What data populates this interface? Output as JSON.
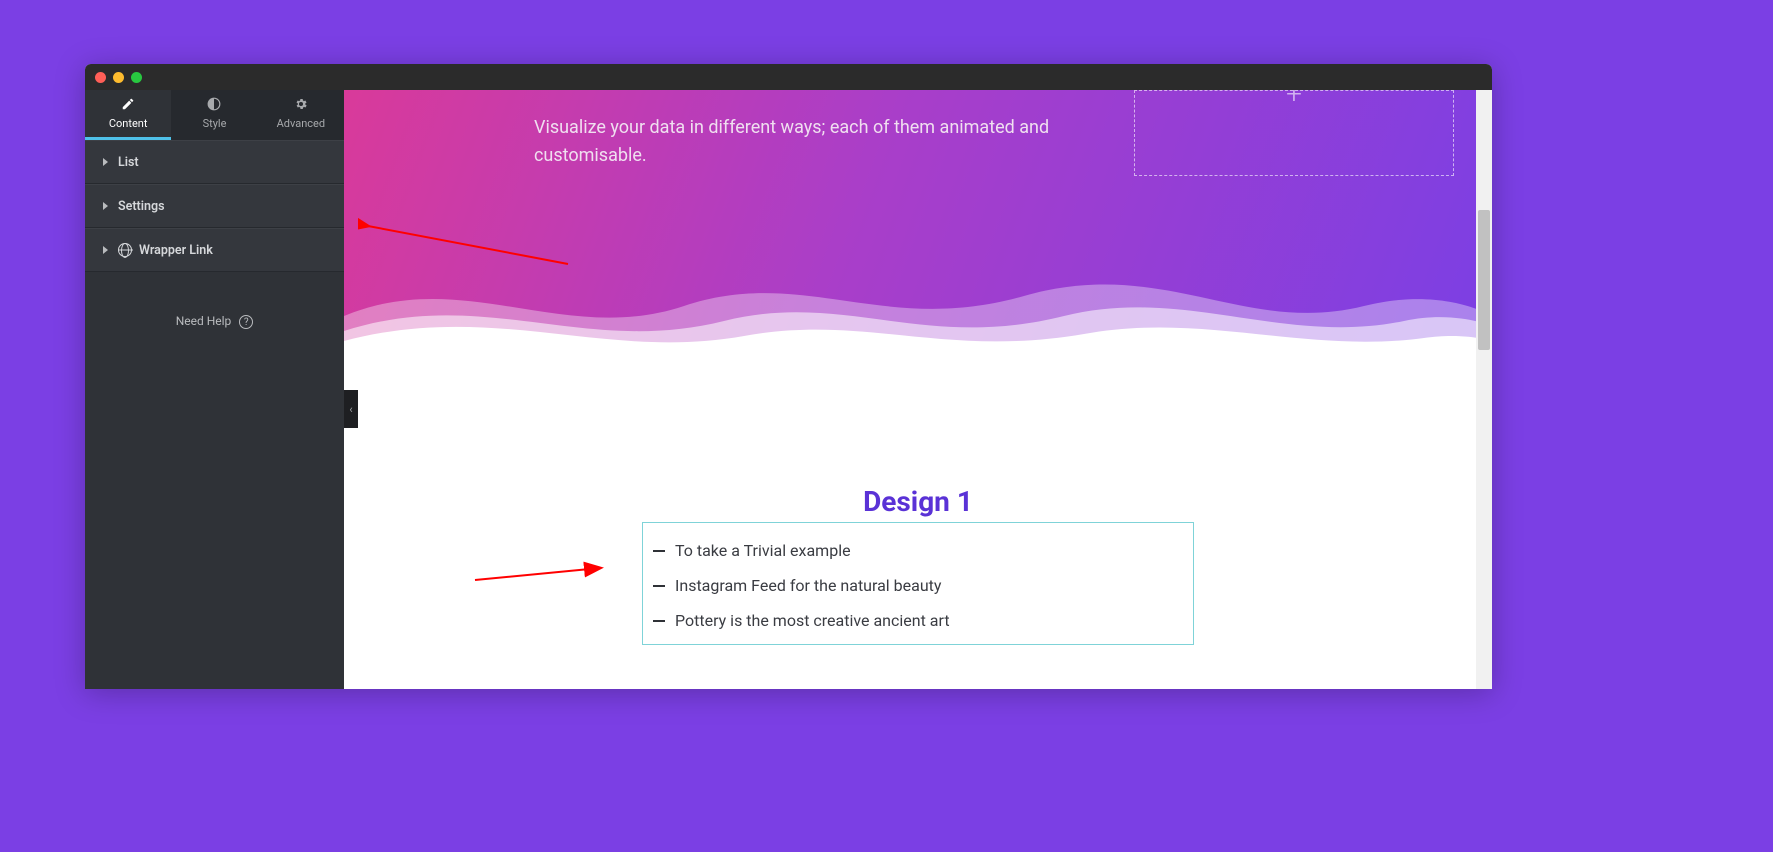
{
  "sidebar": {
    "tabs": [
      {
        "label": "Content",
        "icon": "pencil"
      },
      {
        "label": "Style",
        "icon": "contrast"
      },
      {
        "label": "Advanced",
        "icon": "gear"
      }
    ],
    "panels": [
      {
        "label": "List"
      },
      {
        "label": "Settings"
      },
      {
        "label": "Wrapper Link",
        "icon": "globe"
      }
    ],
    "help_label": "Need Help"
  },
  "hero": {
    "description": "Visualize your data in different ways; each of them animated and customisable."
  },
  "dropzone": {
    "glyph": "+"
  },
  "design": {
    "title": "Design 1",
    "items": [
      "To take a Trivial example",
      "Instagram Feed for the natural beauty",
      "Pottery is the most creative ancient art"
    ]
  },
  "collapse_glyph": "‹"
}
